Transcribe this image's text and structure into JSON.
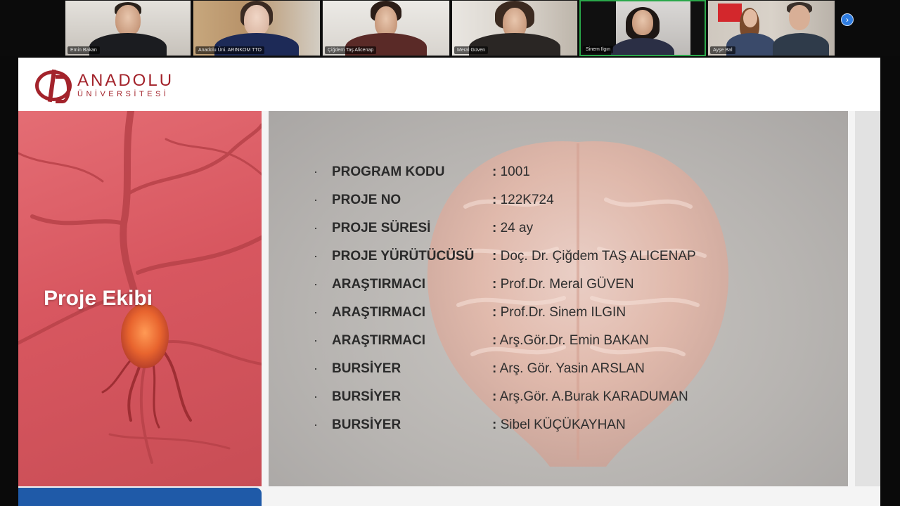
{
  "video_strip": {
    "participants": [
      {
        "name": "Emin Bakan",
        "speaking": false
      },
      {
        "name": "Anadolu Üni. ARINKOM TTO",
        "speaking": false
      },
      {
        "name": "Çiğdem Taş Alicenap",
        "speaking": false
      },
      {
        "name": "Meral Güven",
        "speaking": false
      },
      {
        "name": "Sinem Ilgın",
        "speaking": true
      },
      {
        "name": "Ayşe Bal",
        "speaking": false
      }
    ]
  },
  "slide": {
    "logo": {
      "line1": "ANADOLU",
      "line2": "ÜNİVERSİTESİ"
    },
    "section_title": "Proje Ekibi",
    "rows": [
      {
        "role": "PROGRAM KODU",
        "value": "1001"
      },
      {
        "role": "PROJE NO",
        "value": "122K724"
      },
      {
        "role": "PROJE SÜRESİ",
        "value": "24 ay"
      },
      {
        "role": "PROJE YÜRÜTÜCÜSÜ",
        "value": "Doç. Dr. Çiğdem TAŞ ALICENAP"
      },
      {
        "role": "ARAŞTIRMACI",
        "value": "Prof.Dr. Meral GÜVEN"
      },
      {
        "role": "ARAŞTIRMACI",
        "value": "Prof.Dr. Sinem ILGIN"
      },
      {
        "role": "ARAŞTIRMACI",
        "value": "Arş.Gör.Dr. Emin BAKAN"
      },
      {
        "role": "BURSİYER",
        "value": "Arş. Gör. Yasin ARSLAN"
      },
      {
        "role": "BURSİYER",
        "value": "Arş.Gör. A.Burak KARADUMAN"
      },
      {
        "role": "BURSİYER",
        "value": "Sibel KÜÇÜKAYHAN"
      }
    ],
    "bullet_char": "·",
    "separator": ":"
  },
  "colors": {
    "brand_red": "#a3232b",
    "speaking_border": "#2aa84a",
    "band_blue": "#1f5aa8"
  }
}
